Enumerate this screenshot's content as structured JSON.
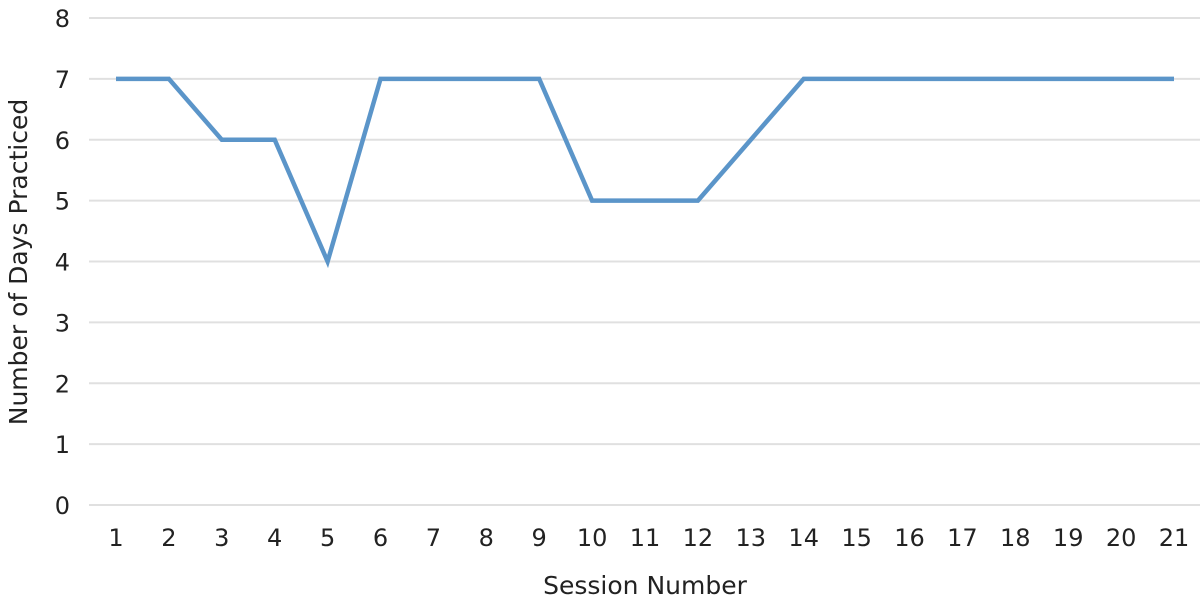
{
  "chart_data": {
    "type": "line",
    "title": "",
    "xlabel": "Session Number",
    "ylabel": "Number of Days Practiced",
    "x": [
      1,
      2,
      3,
      4,
      5,
      6,
      7,
      8,
      9,
      10,
      11,
      12,
      13,
      14,
      15,
      16,
      17,
      18,
      19,
      20,
      21
    ],
    "categories": [
      "1",
      "2",
      "3",
      "4",
      "5",
      "6",
      "7",
      "8",
      "9",
      "10",
      "11",
      "12",
      "13",
      "14",
      "15",
      "16",
      "17",
      "18",
      "19",
      "20",
      "21"
    ],
    "series": [
      {
        "name": "Days Practiced",
        "values": [
          7,
          7,
          6,
          6,
          4,
          7,
          7,
          7,
          7,
          5,
          5,
          5,
          6,
          7,
          7,
          7,
          7,
          7,
          7,
          7,
          7
        ],
        "color": "#5b95c9"
      }
    ],
    "ylim": [
      0,
      8
    ],
    "yticks": [
      "0",
      "1",
      "2",
      "3",
      "4",
      "5",
      "6",
      "7",
      "8"
    ],
    "grid": true,
    "gridColor": "#e0e0e0",
    "legend": "none"
  }
}
